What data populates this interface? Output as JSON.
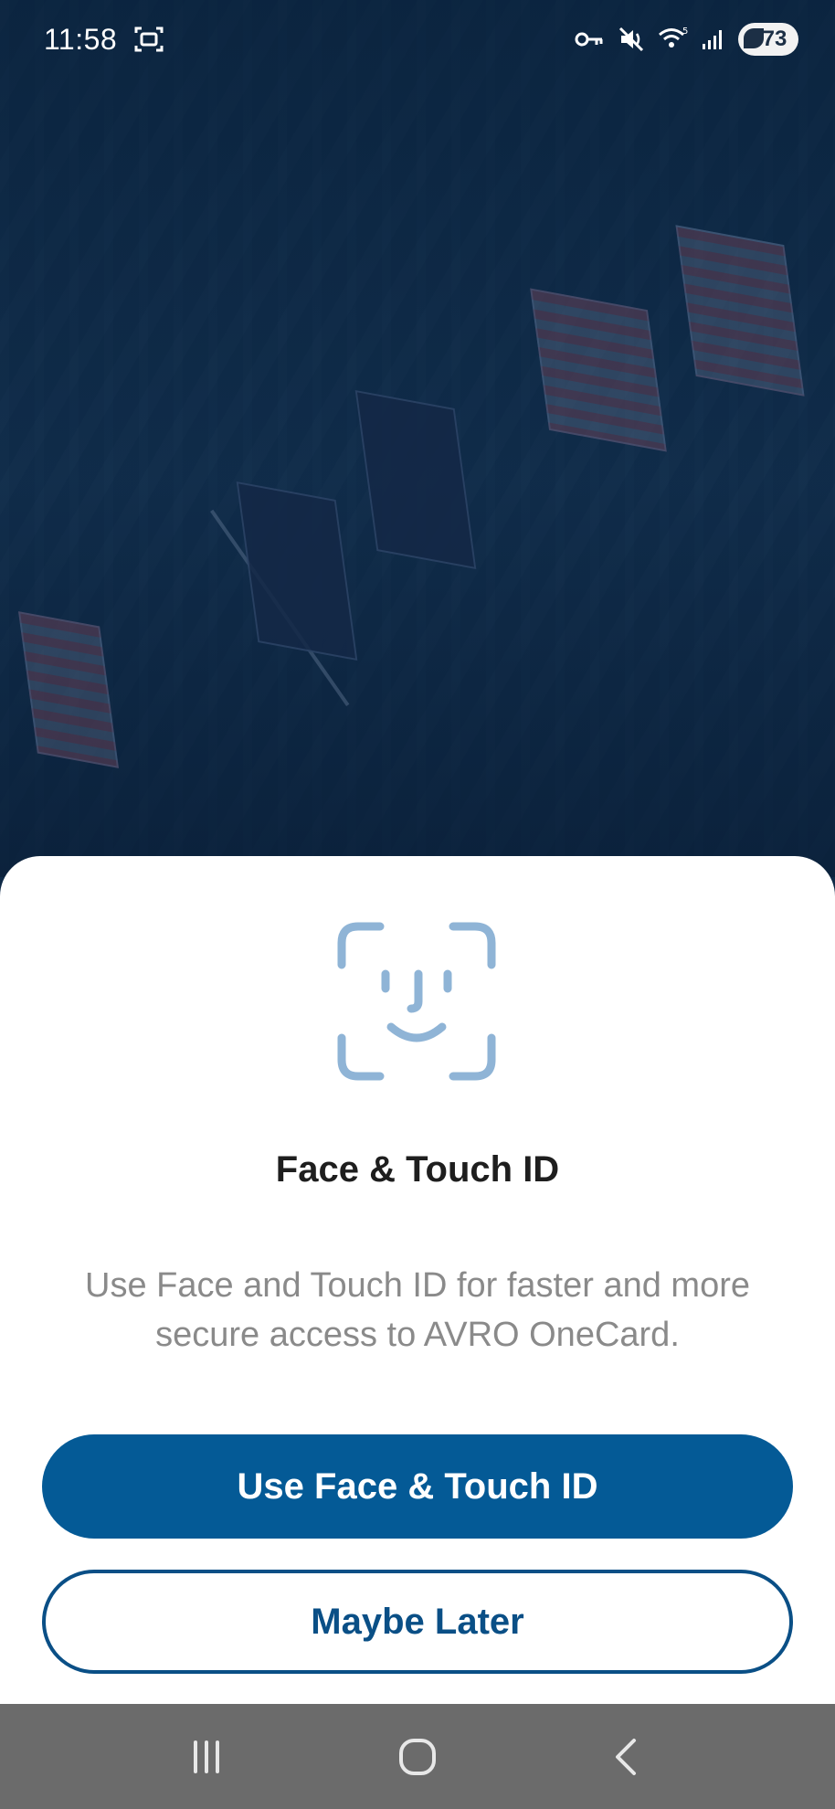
{
  "status_bar": {
    "time": "11:58",
    "battery_level": "73",
    "icons": [
      "screenshot-icon",
      "vpn-key-icon",
      "mute-icon",
      "wifi-icon",
      "signal-icon",
      "battery-icon"
    ]
  },
  "sheet": {
    "icon": "face-id-icon",
    "title": "Face & Touch ID",
    "description": "Use Face and Touch ID for faster and more secure access to AVRO OneCard.",
    "primary_button": "Use Face & Touch ID",
    "secondary_button": "Maybe Later"
  },
  "nav_bar": {
    "icons": [
      "recent-apps-icon",
      "home-icon",
      "back-icon"
    ]
  },
  "colors": {
    "primary": "#045a96",
    "secondary_border": "#0a4f86",
    "face_icon": "#8fb4d6",
    "background_overlay": "#0f2a47",
    "nav_bar": "#6b6b6b"
  }
}
